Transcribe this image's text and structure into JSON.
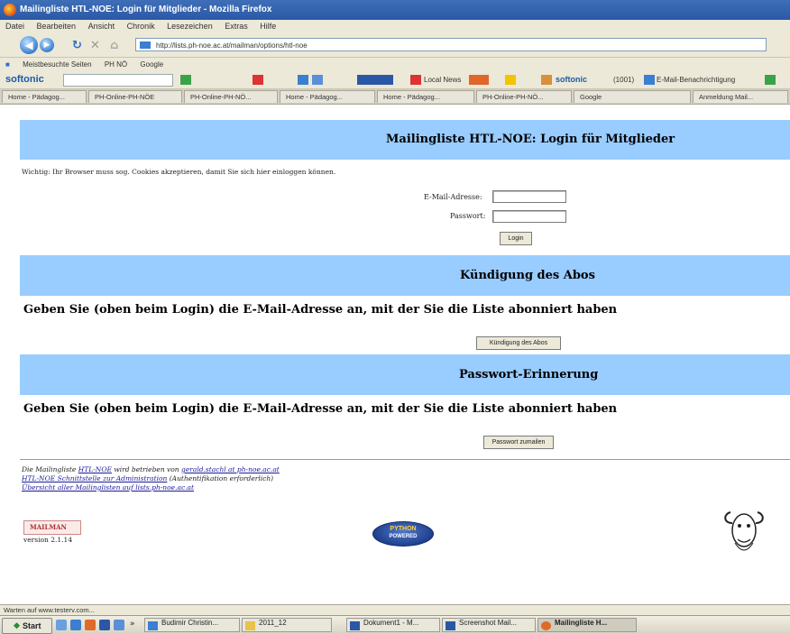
{
  "window": {
    "title": "Mailingliste HTL-NOE: Login für Mitglieder - Mozilla Firefox"
  },
  "menu": [
    "Datei",
    "Bearbeiten",
    "Ansicht",
    "Chronik",
    "Lesezeichen",
    "Extras",
    "Hilfe"
  ],
  "url": "http://lists.ph-noe.ac.at/mailman/options/htl-noe",
  "bookmarks": [
    "Meistbesuchte Seiten",
    "PH NÖ",
    "Google"
  ],
  "softonic": {
    "logo": "softonic",
    "items": [
      "Local News",
      "softonic",
      "(1001)",
      "E-Mail-Benachrichtigung"
    ]
  },
  "tabs": [
    "Home - Pädagog...",
    "PH-Online-PH-NÖE",
    "PH-Online-PH-NÖ...",
    "Home - Pädagog...",
    "Home - Pädagog...",
    "PH-Online-PH-NÖ...",
    "Google",
    "Anmeldung Mail..."
  ],
  "page": {
    "login_header": "Mailingliste HTL-NOE: Login für Mitglieder",
    "notice": "Wichtig: Ihr Browser muss sog. Cookies akzeptieren, damit Sie sich hier einloggen können.",
    "email_label": "E-Mail-Adresse:",
    "password_label": "Passwort:",
    "login_button": "Login",
    "unsub_header": "Kündigung des Abos",
    "unsub_text": "Geben Sie (oben beim Login) die E-Mail-Adresse an, mit der Sie die Liste abonniert haben",
    "unsub_button": "Kündigung des Abos",
    "pw_header": "Passwort-Erinnerung",
    "pw_text": "Geben Sie (oben beim Login) die E-Mail-Adresse an, mit der Sie die Liste abonniert haben",
    "pw_button": "Passwort zumailen",
    "footer_line1_pre": "Die Mailingliste ",
    "footer_line1_link": "HTL-NOE",
    "footer_line1_mid": " wird betrieben von ",
    "footer_line1_email": "gerald.stachl at ph-noe.ac.at",
    "footer_line2_link": "HTL-NOE Schnittstelle zur Administration",
    "footer_line2_post": " (Authentifikation erforderlich)",
    "footer_line3_link": "Übersicht aller Mailinglisten auf lists.ph-noe.ac.at",
    "mailman_logo_text": "MAILMAN",
    "version": "version 2.1.14",
    "python_logo_line1": "PYTHON",
    "python_logo_line2": "POWERED"
  },
  "status": "Warten auf www.testerv.com...",
  "taskbar": {
    "start": "Start",
    "tasks": [
      "Budimir Christin...",
      "2011_12",
      "Dokument1 - M...",
      "Screenshot Mail...",
      "Mailingliste H..."
    ]
  },
  "colors": {
    "header_blue": "#99ccff",
    "titlebar": "#2a58a6"
  }
}
